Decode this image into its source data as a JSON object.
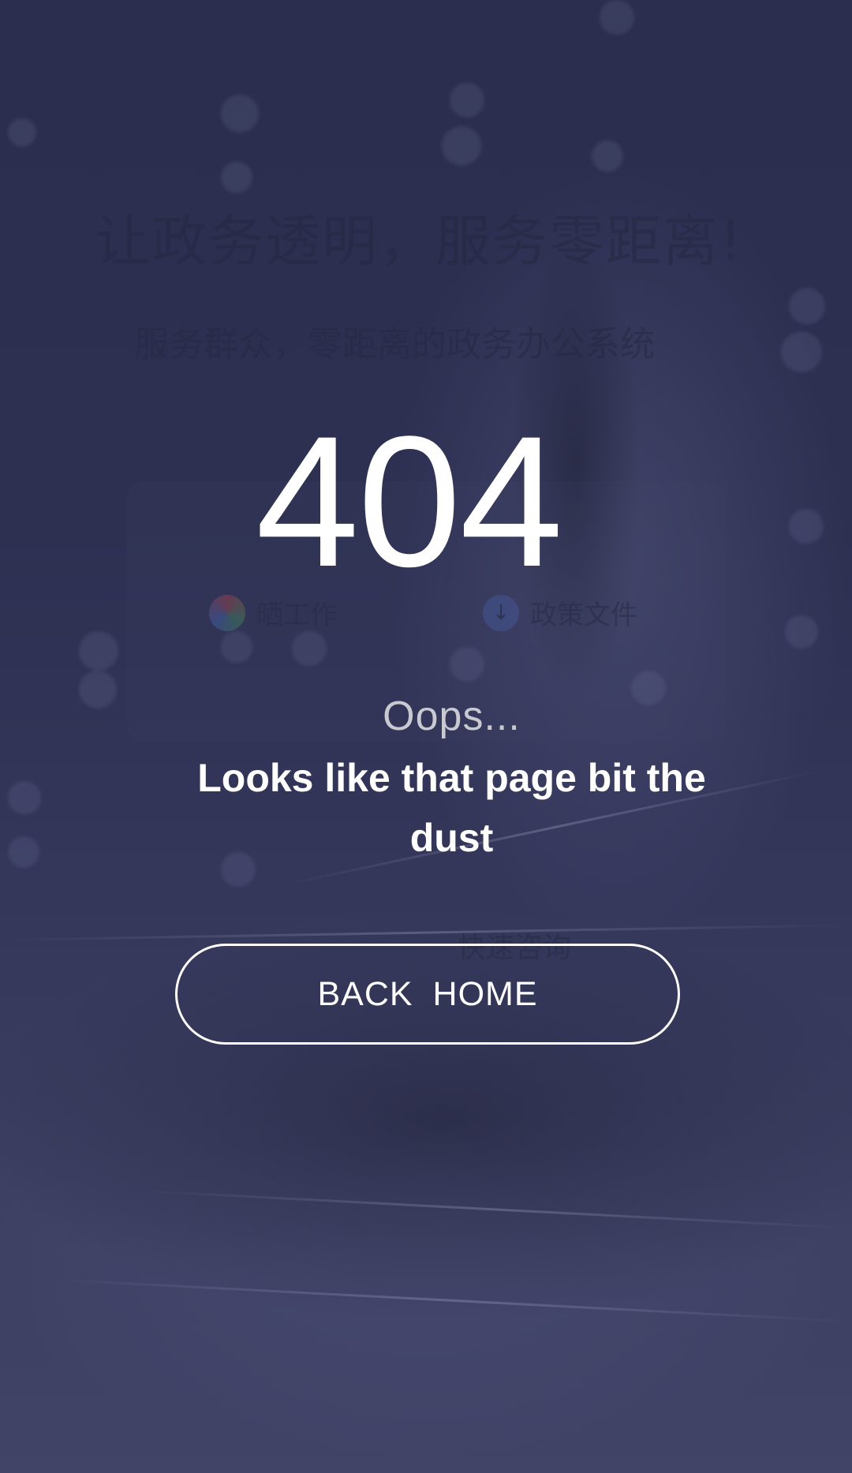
{
  "background": {
    "ghost_headline": "让政务透明，服务零距离!",
    "ghost_subtitle": "服务群众，零距离的政务办公系统",
    "ghost_items": [
      {
        "icon": "shutter-icon",
        "label": "晒工作"
      },
      {
        "icon": "download-icon",
        "label": "政策文件"
      },
      {
        "icon": "",
        "label": "快速咨询"
      }
    ]
  },
  "error": {
    "code": "404",
    "oops": "Oops...",
    "message": "Looks like that page bit the dust"
  },
  "actions": {
    "back_home_label": "BACK  HOME"
  },
  "colors": {
    "background": "#2d3050",
    "text_primary": "#ffffff",
    "text_secondary": "#c9c9d2"
  }
}
